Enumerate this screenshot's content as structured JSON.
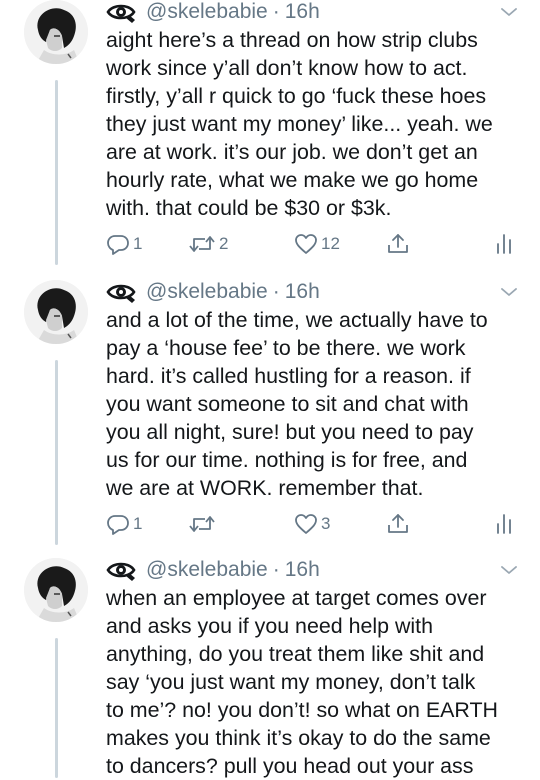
{
  "tweets": [
    {
      "handle": "@skelebabie",
      "dot": "·",
      "time": "16h",
      "lines": [
        "aight here’s a thread on how strip clubs",
        "work since y’all don’t know how to act.",
        "firstly, y’all r quick to go ‘fuck these hoes",
        "they just want my money’ like... yeah. we",
        "are at work. it’s our job. we don’t get an",
        "hourly rate, what we make we go home",
        "with. that could be $30 or $3k."
      ],
      "replies": "1",
      "retweets": "2",
      "likes": "12"
    },
    {
      "handle": "@skelebabie",
      "dot": "·",
      "time": "16h",
      "lines": [
        "and a lot of the time, we actually have to",
        "pay a ‘house fee’ to be there. we work",
        "hard. it’s called hustling for a reason. if",
        "you want someone to sit and chat with",
        "you all night, sure! but you need to pay",
        "us for our time. nothing is for free, and",
        "we are at WORK. remember that."
      ],
      "replies": "1",
      "retweets": "",
      "likes": "3"
    },
    {
      "handle": "@skelebabie",
      "dot": "·",
      "time": "16h",
      "lines": [
        "when an employee at target comes over",
        "and asks you if you need help with",
        "anything, do you treat them like shit and",
        "say ‘you just want my money, don’t talk",
        "to me’? no! you don’t! so what on EARTH",
        "makes you think it’s okay to do the same",
        "to dancers? pull you head out your ass"
      ]
    }
  ],
  "icons": {
    "header": "eye-icon",
    "reply": "reply-icon",
    "retweet": "retweet-icon",
    "like": "heart-icon",
    "share": "share-icon",
    "analytics": "analytics-icon",
    "menu": "chevron-down-icon"
  },
  "colors": {
    "text": "#14171a",
    "secondary": "#657786",
    "thread_line": "#ccd6dd",
    "background": "#ffffff"
  }
}
